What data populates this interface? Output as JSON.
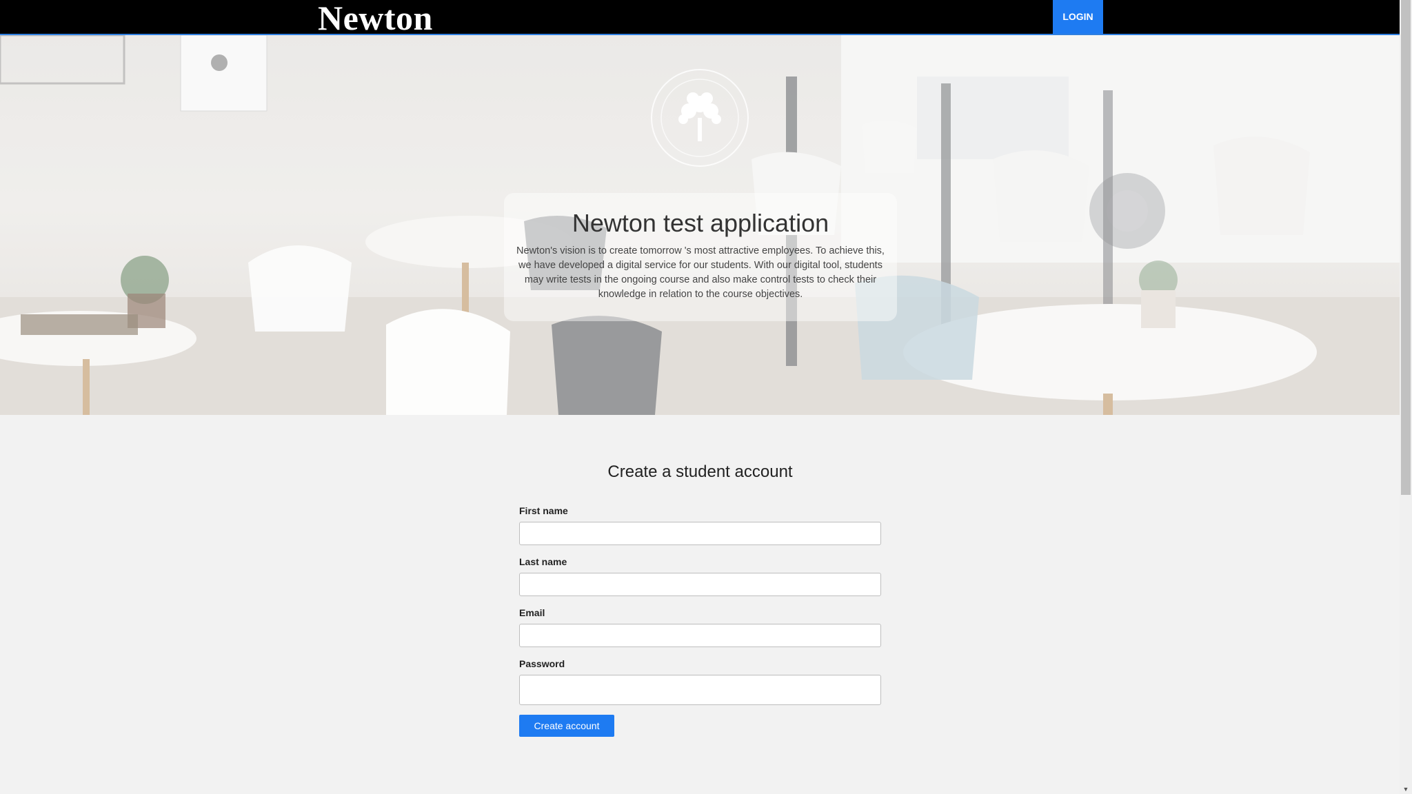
{
  "header": {
    "brand": "Newton",
    "login_label": "LOGIN"
  },
  "hero": {
    "title": "Newton test application",
    "description": "Newton's vision is to create tomorrow 's most attractive employees. To achieve this, we have developed a digital service for our students. With our digital tool, students may write tests in the ongoing course and also make control tests to check their knowledge in relation to the course objectives.",
    "logo_icon": "tree-seal-icon"
  },
  "form": {
    "title": "Create a student account",
    "fields": [
      {
        "label": "First name",
        "value": "",
        "placeholder": ""
      },
      {
        "label": "Last name",
        "value": "",
        "placeholder": ""
      },
      {
        "label": "Email",
        "value": "",
        "placeholder": ""
      },
      {
        "label": "Password",
        "value": "",
        "placeholder": ""
      }
    ],
    "submit_label": "Create account"
  },
  "colors": {
    "accent": "#1e7bf2",
    "topbar": "#000000",
    "page_bg": "#f2f2f2"
  }
}
